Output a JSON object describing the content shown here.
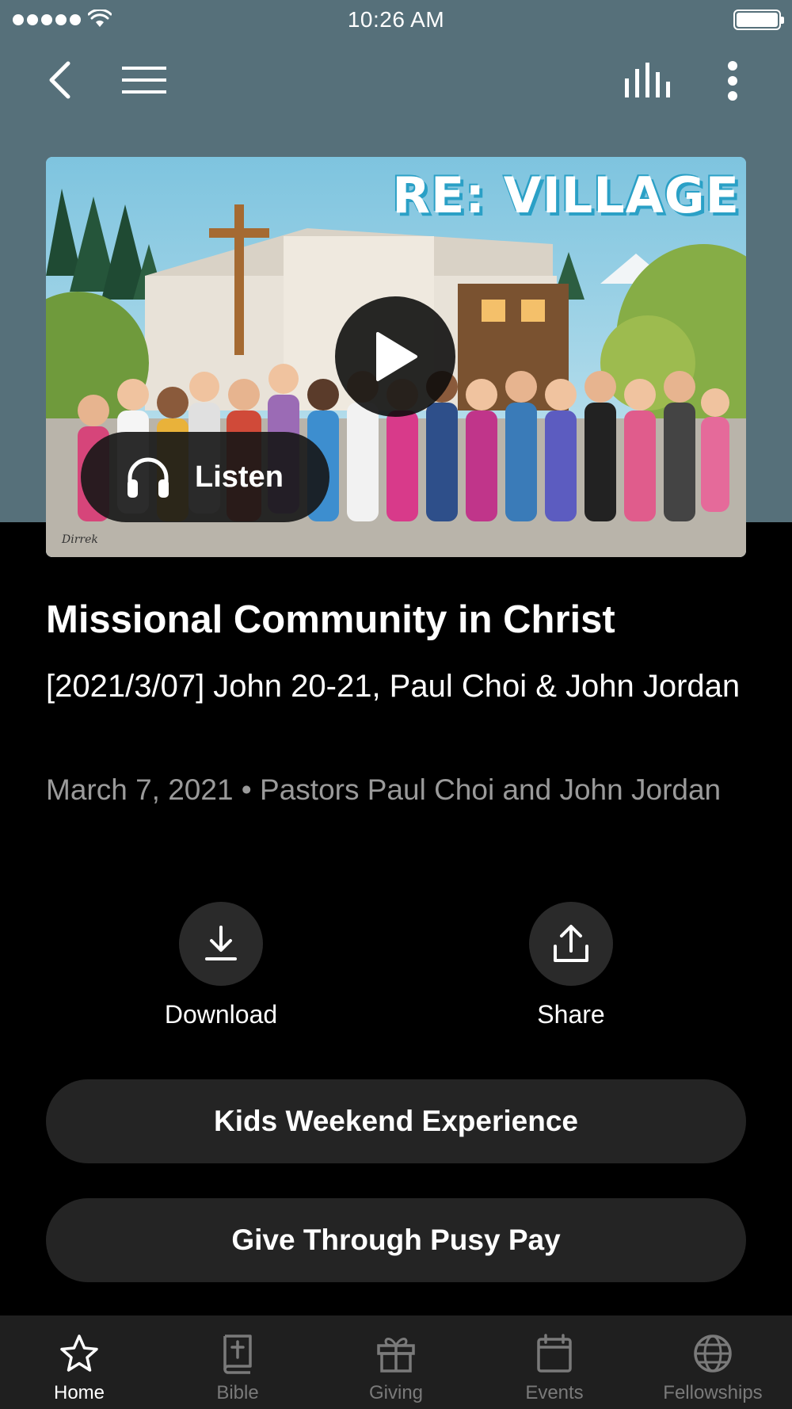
{
  "status_bar": {
    "time": "10:26 AM"
  },
  "nav": {
    "back_icon": "chevron-left-icon",
    "menu_icon": "hamburger-menu-icon",
    "audio_icon": "audio-bars-icon",
    "more_icon": "more-vertical-icon"
  },
  "artwork": {
    "title": "RE: VILLAGE",
    "signature": "Dirrek"
  },
  "media": {
    "play_icon": "play-icon",
    "listen_label": "Listen",
    "listen_icon": "headphones-icon"
  },
  "sermon": {
    "title": "Missional Community in Christ",
    "subtitle": "[2021/3/07] John 20-21, Paul Choi & John Jordan",
    "meta": "March 7, 2021 • Pastors Paul Choi and John Jordan"
  },
  "actions": {
    "download_label": "Download",
    "share_label": "Share"
  },
  "buttons": {
    "kids": "Kids Weekend Experience",
    "give": "Give Through Pusy Pay"
  },
  "tabbar": {
    "items": [
      {
        "label": "Home",
        "icon": "star-icon",
        "active": true
      },
      {
        "label": "Bible",
        "icon": "bible-icon",
        "active": false
      },
      {
        "label": "Giving",
        "icon": "gift-icon",
        "active": false
      },
      {
        "label": "Events",
        "icon": "calendar-icon",
        "active": false
      },
      {
        "label": "Fellowships",
        "icon": "globe-icon",
        "active": false
      }
    ]
  },
  "colors": {
    "header_bg": "#56707a",
    "page_bg": "#000000",
    "button_bg": "#242424",
    "tabbar_bg": "#1f1f1f",
    "muted_text": "#9a9a9a"
  }
}
